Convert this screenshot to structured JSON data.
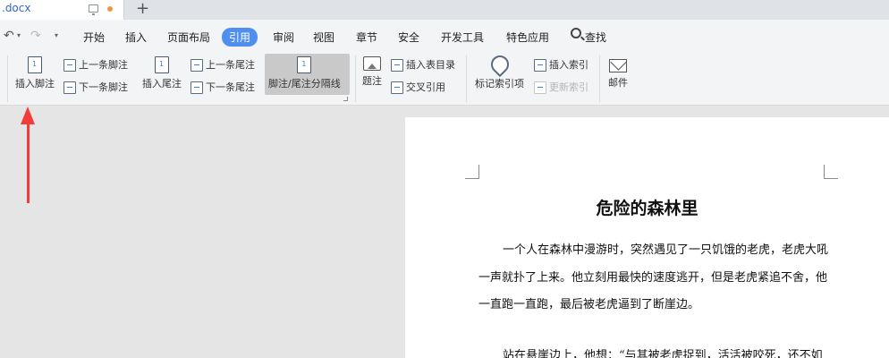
{
  "tab": {
    "title": ".docx"
  },
  "menu": {
    "items": [
      "开始",
      "插入",
      "页面布局",
      "引用",
      "审阅",
      "视图",
      "章节",
      "安全",
      "开发工具",
      "特色应用"
    ],
    "active": "引用",
    "search_label": "查找"
  },
  "ribbon": {
    "insert_footnote": "插入脚注",
    "prev_footnote": "上一条脚注",
    "next_footnote": "下一条脚注",
    "insert_endnote": "插入尾注",
    "prev_endnote": "上一条尾注",
    "next_endnote": "下一条尾注",
    "separator_line": "脚注/尾注分隔线",
    "caption": "题注",
    "insert_toc": "插入表目录",
    "cross_ref": "交叉引用",
    "mark_index": "标记索引项",
    "insert_index": "插入索引",
    "update_index": "更新索引",
    "mail": "邮件"
  },
  "document": {
    "title": "危险的森林里",
    "lines": [
      "一个人在森林中漫游时，突然遇见了一只饥饿的老虎，老虎大吼",
      "一声就扑了上来。他立刻用最快的速度逃开，但是老虎紧追不舍，他",
      "一直跑一直跑，最后被老虎逼到了断崖边。",
      "站在悬崖边上，他想：“与其被老虎捉到，活活被咬死，还不如"
    ]
  },
  "colors": {
    "accent": "#4f8ff0",
    "arrow": "#f23c3c"
  }
}
